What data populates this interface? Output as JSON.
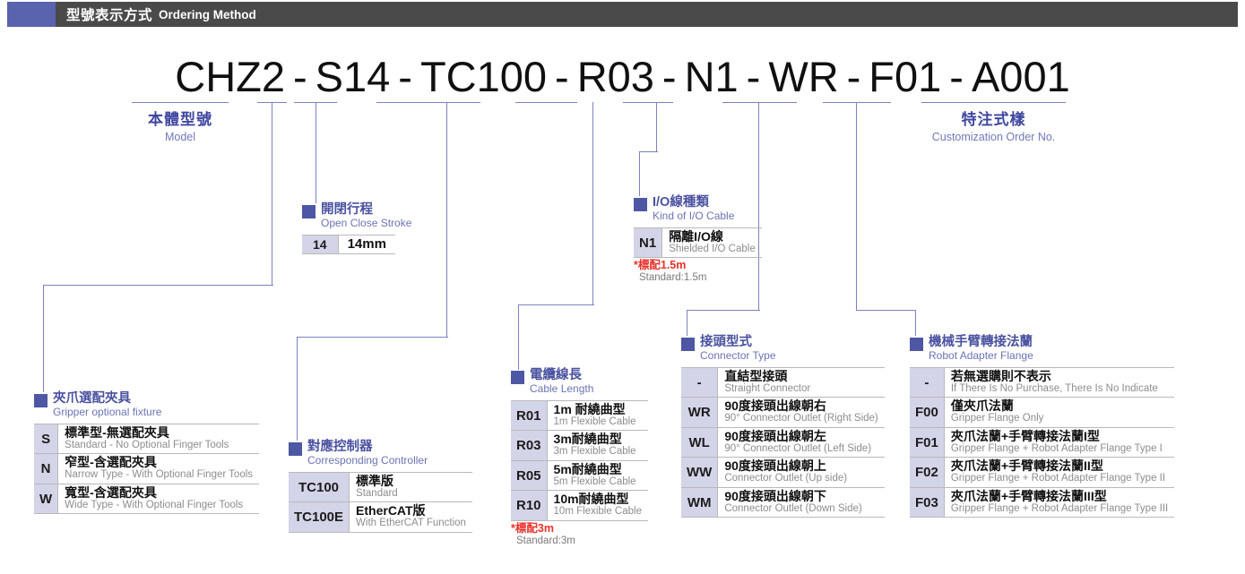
{
  "header": {
    "title_cn": "型號表示方式",
    "title_en": "Ordering Method",
    "square_color": "#5a63ad",
    "bar_color": "#4a4a4a"
  },
  "model_number": {
    "segments": [
      "CHZ2",
      "S14",
      "TC100",
      "R03",
      "N1",
      "WR",
      "F01",
      "A001"
    ],
    "separator": "-",
    "full": "CHZ2 - S14 - TC100 - R03 - N1 - WR - F01 - A001"
  },
  "accent_colors": {
    "line": "#7b82c0",
    "section_square": "#4d57a4",
    "section_cn_text": "#4a52a0",
    "section_en_text": "#6b73b5",
    "key_cell_bg": "#d3d4e8",
    "note_red": "#e8312a"
  },
  "labels": {
    "model": {
      "cn": "本體型號",
      "en": "Model"
    },
    "customization": {
      "cn": "特注式樣",
      "en": "Customization Order No."
    }
  },
  "sections": {
    "gripper": {
      "cn": "夾爪選配夾具",
      "en": "Gripper optional fixture",
      "rows": [
        {
          "key": "S",
          "cn": "標準型-無選配夾具",
          "en": "Standard - No Optional Finger Tools"
        },
        {
          "key": "N",
          "cn": "窄型-含選配夾具",
          "en": "Narrow Type - With Optional Finger Tools"
        },
        {
          "key": "W",
          "cn": "寬型-含選配夾具",
          "en": "Wide Type - With Optional Finger Tools"
        }
      ]
    },
    "stroke": {
      "cn": "開閉行程",
      "en": "Open Close Stroke",
      "rows": [
        {
          "key": "14",
          "cn": "14mm",
          "en": ""
        }
      ]
    },
    "controller": {
      "cn": "對應控制器",
      "en": "Corresponding Controller",
      "rows": [
        {
          "key": "TC100",
          "cn": "標準版",
          "en": "Standard"
        },
        {
          "key": "TC100E",
          "cn": "EtherCAT版",
          "en": "With EtherCAT Function"
        }
      ]
    },
    "cable_length": {
      "cn": "電纜線長",
      "en": "Cable Length",
      "rows": [
        {
          "key": "R01",
          "cn": "1m 耐繞曲型",
          "en": "1m Flexible Cable"
        },
        {
          "key": "R03",
          "cn": "3m耐繞曲型",
          "en": "3m Flexible Cable"
        },
        {
          "key": "R05",
          "cn": "5m耐繞曲型",
          "en": "5m Flexible Cable"
        },
        {
          "key": "R10",
          "cn": "10m耐繞曲型",
          "en": "10m Flexible Cable"
        }
      ],
      "note_cn": "*標配3m",
      "note_en": "Standard:3m"
    },
    "io_cable": {
      "cn": "I/O線種類",
      "en": "Kind of I/O Cable",
      "rows": [
        {
          "key": "N1",
          "cn": "隔離I/O線",
          "en": "Shielded I/O Cable"
        }
      ],
      "note_cn": "*標配1.5m",
      "note_en": "Standard:1.5m"
    },
    "connector": {
      "cn": "接頭型式",
      "en": "Connector Type",
      "rows": [
        {
          "key": "-",
          "cn": "直結型接頭",
          "en": "Straight Connector"
        },
        {
          "key": "WR",
          "cn": "90度接頭出線朝右",
          "en": "90° Connector Outlet (Right Side)"
        },
        {
          "key": "WL",
          "cn": "90度接頭出線朝左",
          "en": "90° Connector Outlet (Left Side)"
        },
        {
          "key": "WW",
          "cn": "90度接頭出線朝上",
          "en": "Connector Outlet (Up side)"
        },
        {
          "key": "WM",
          "cn": "90度接頭出線朝下",
          "en": "Connector Outlet (Down Side)"
        }
      ]
    },
    "flange": {
      "cn": "機械手臂轉接法蘭",
      "en": "Robot Adapter Flange",
      "rows": [
        {
          "key": "-",
          "cn": "若無選購則不表示",
          "en": "If There Is No Purchase, There Is No Indicate"
        },
        {
          "key": "F00",
          "cn": "僅夾爪法蘭",
          "en": "Gripper Flange Only"
        },
        {
          "key": "F01",
          "cn": "夾爪法蘭+手臂轉接法蘭I型",
          "en": "Gripper Flange + Robot Adapter Flange Type I"
        },
        {
          "key": "F02",
          "cn": "夾爪法蘭+手臂轉接法蘭II型",
          "en": "Gripper Flange + Robot Adapter Flange Type II"
        },
        {
          "key": "F03",
          "cn": "夾爪法蘭+手臂轉接法蘭III型",
          "en": "Gripper Flange + Robot Adapter Flange Type III"
        }
      ]
    }
  }
}
